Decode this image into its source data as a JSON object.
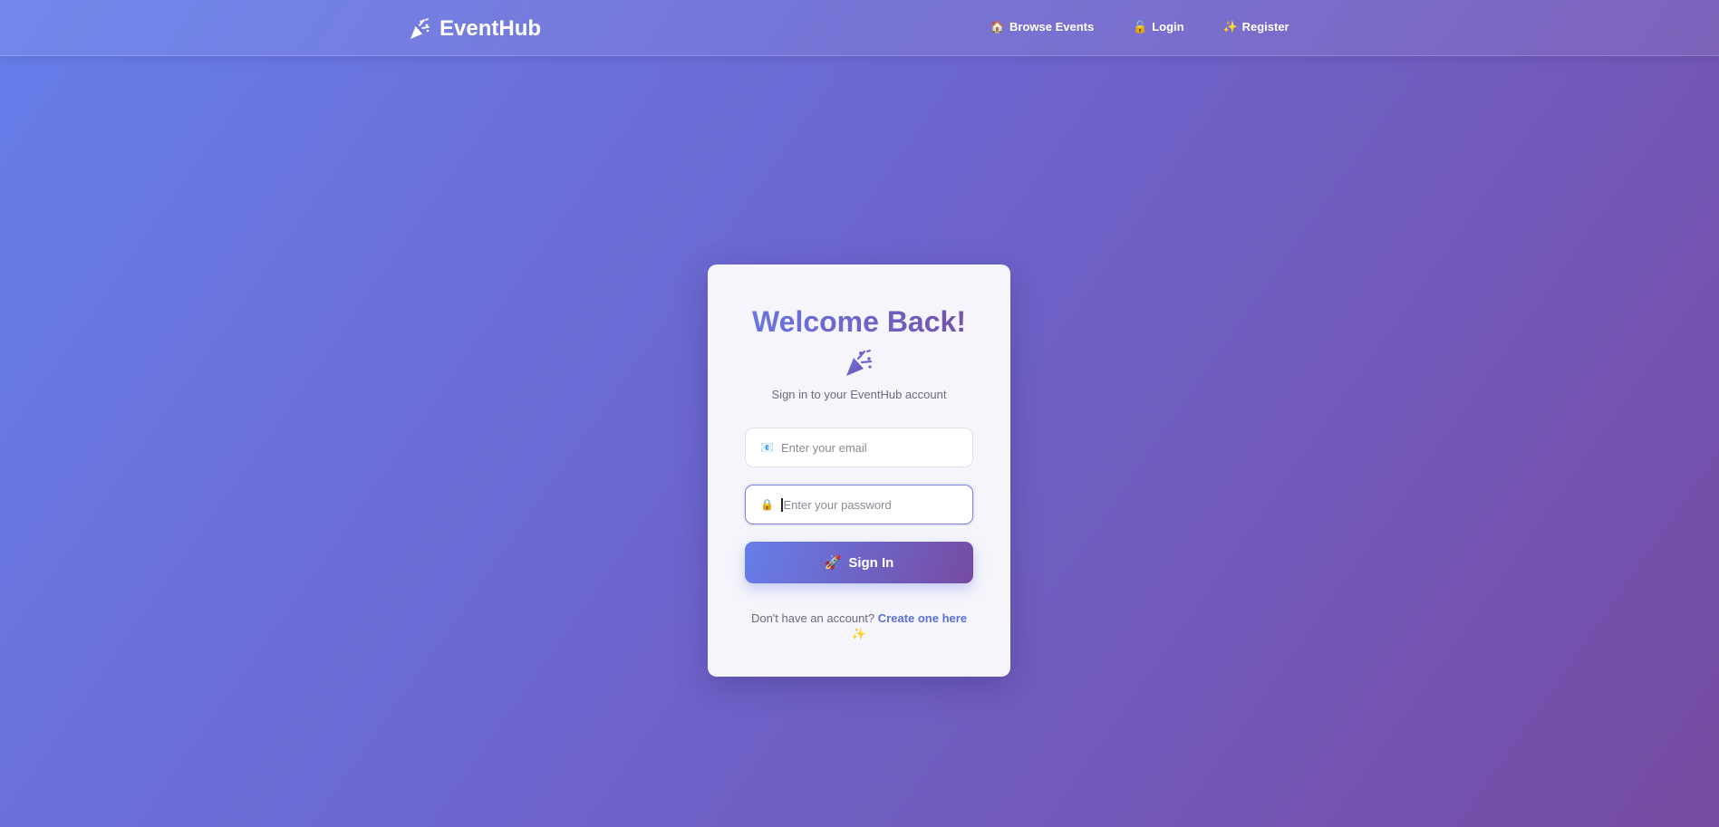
{
  "nav": {
    "brand": "EventHub",
    "brand_icon": "party-popper-icon",
    "links": [
      {
        "label": "Browse Events",
        "icon": "🏠"
      },
      {
        "label": "Login",
        "icon": "🔓"
      },
      {
        "label": "Register",
        "icon": "✨"
      }
    ]
  },
  "login": {
    "title": "Welcome Back!",
    "title_icon": "party-popper-icon",
    "subtitle": "Sign in to your EventHub account",
    "email_icon": "📧",
    "email_placeholder": "Enter your email",
    "password_icon": "🔒",
    "password_placeholder": "Enter your password",
    "signin_icon": "🚀",
    "signin_label": "Sign In",
    "footer_prompt": "Don't have an account?",
    "footer_link": "Create one here",
    "footer_icon": "✨"
  },
  "colors": {
    "gradient_start": "#667eea",
    "gradient_end": "#764ba2",
    "link": "#5a6fd8"
  }
}
